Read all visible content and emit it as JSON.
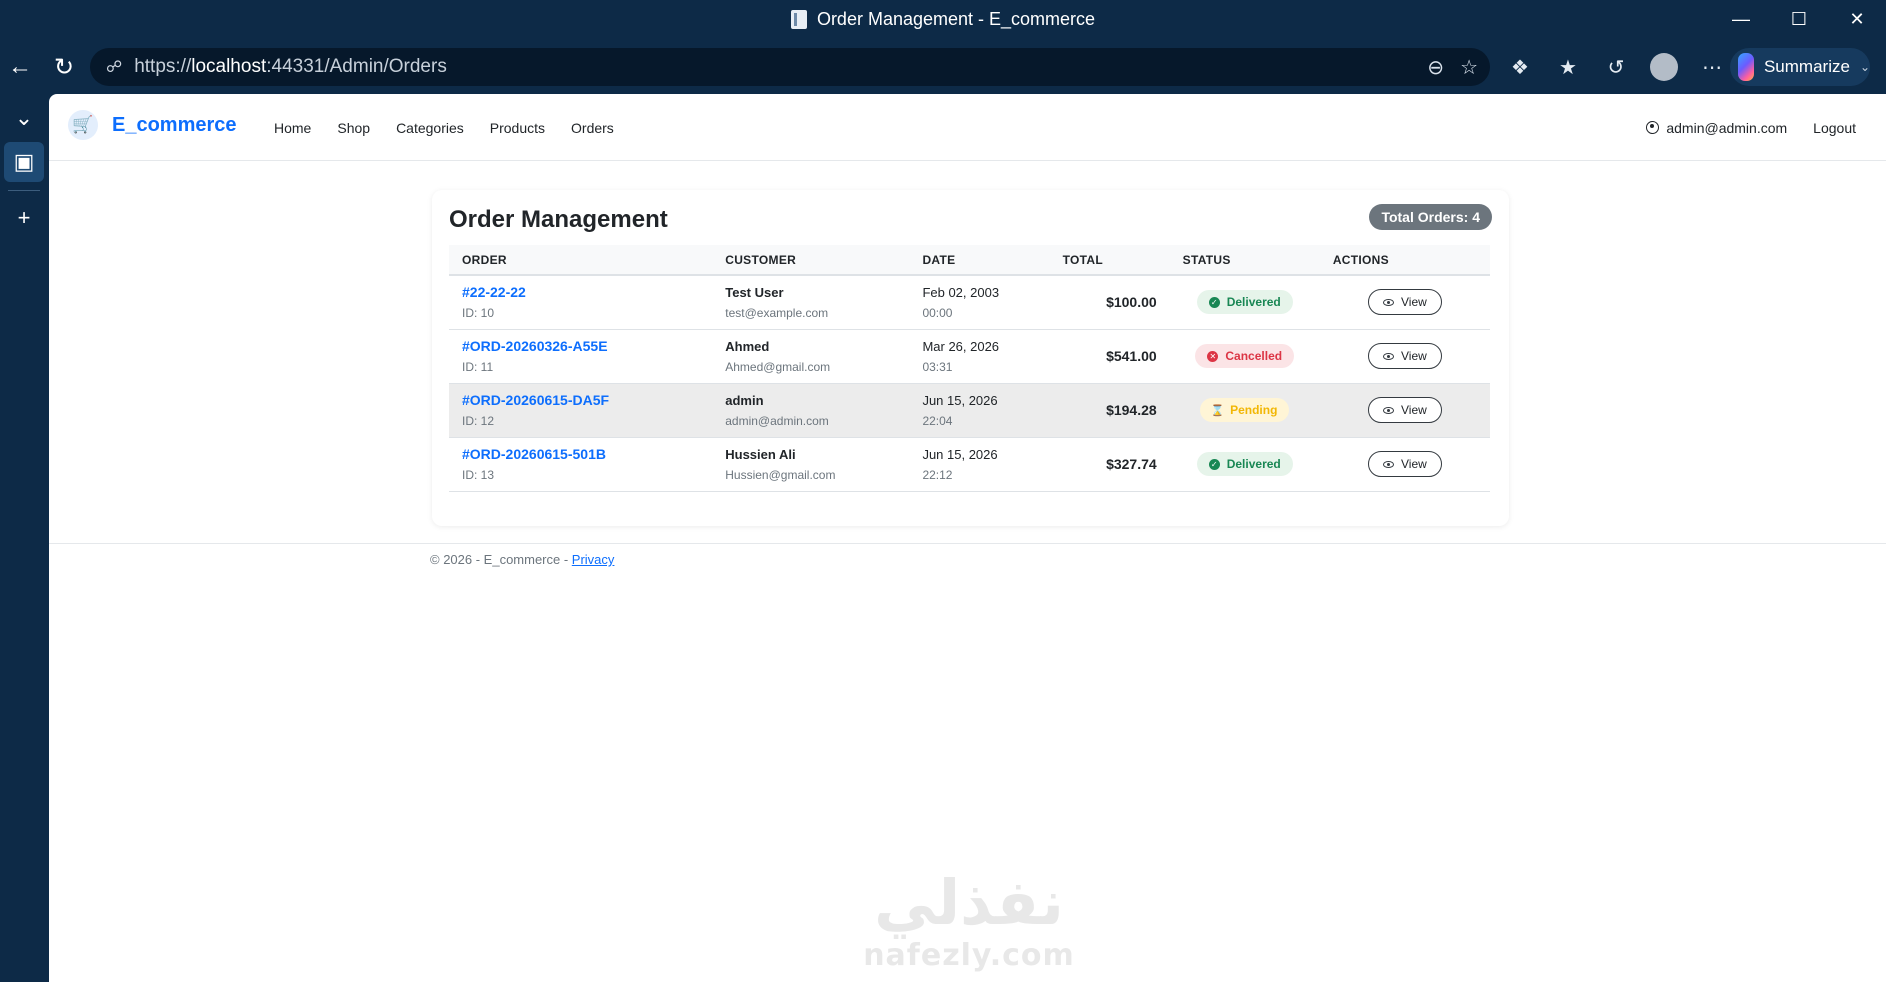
{
  "window": {
    "title": "Order Management - E_commerce"
  },
  "browser": {
    "url_prefix": "https://",
    "url_host": "localhost",
    "url_rest": ":44331/Admin/Orders",
    "summarize_label": "Summarize"
  },
  "navbar": {
    "brand": "E_commerce",
    "links": [
      "Home",
      "Shop",
      "Categories",
      "Products",
      "Orders"
    ],
    "user_email": "admin@admin.com",
    "logout": "Logout"
  },
  "orders_card": {
    "title": "Order Management",
    "total_badge": "Total Orders: 4",
    "columns": [
      "ORDER",
      "CUSTOMER",
      "DATE",
      "TOTAL",
      "STATUS",
      "ACTIONS"
    ],
    "rows": [
      {
        "order_no": "#22-22-22",
        "id": "ID: 10",
        "customer": "Test User",
        "email": "test@example.com",
        "date": "Feb 02, 2003",
        "time": "00:00",
        "total": "$100.00",
        "status": "Delivered",
        "action": "View"
      },
      {
        "order_no": "#ORD-20260326-A55E",
        "id": "ID: 11",
        "customer": "Ahmed",
        "email": "Ahmed@gmail.com",
        "date": "Mar 26, 2026",
        "time": "03:31",
        "total": "$541.00",
        "status": "Cancelled",
        "action": "View"
      },
      {
        "order_no": "#ORD-20260615-DA5F",
        "id": "ID: 12",
        "customer": "admin",
        "email": "admin@admin.com",
        "date": "Jun 15, 2026",
        "time": "22:04",
        "total": "$194.28",
        "status": "Pending",
        "action": "View"
      },
      {
        "order_no": "#ORD-20260615-501B",
        "id": "ID: 13",
        "customer": "Hussien Ali",
        "email": "Hussien@gmail.com",
        "date": "Jun 15, 2026",
        "time": "22:12",
        "total": "$327.74",
        "status": "Delivered",
        "action": "View"
      }
    ]
  },
  "footer": {
    "text": "© 2026 - E_commerce - ",
    "privacy": "Privacy"
  },
  "watermark": {
    "script": "نفذلي",
    "site": "nafezly.com"
  },
  "colors": {
    "chrome": "#0d2a47",
    "primary": "#0d6efd",
    "delivered": "#198754",
    "cancelled": "#dc3545",
    "pending": "#f2b705",
    "badge": "#6c757d"
  },
  "icons": {
    "back": "arrow-left-icon",
    "refresh": "refresh-icon",
    "lock": "lock-icon",
    "zoom": "zoom-out-icon",
    "favorite": "star-icon",
    "extensions": "puzzle-icon",
    "favorites": "favorites-icon",
    "history": "history-icon",
    "profile": "avatar",
    "more": "more-icon",
    "cart": "cart-icon",
    "user": "user-circle-icon",
    "view": "eye-icon"
  }
}
